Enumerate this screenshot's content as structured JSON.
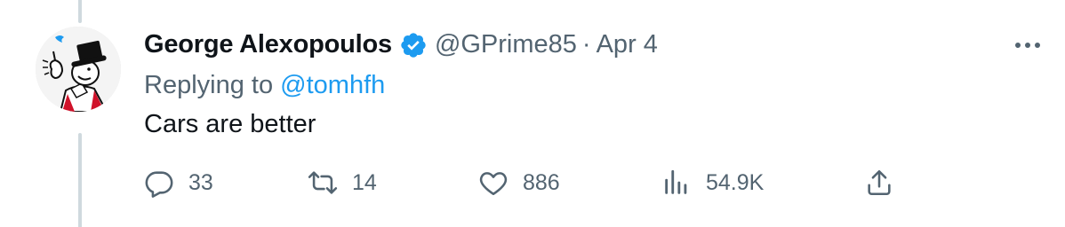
{
  "tweet": {
    "author": {
      "display_name": "George Alexopoulos",
      "handle": "@GPrime85",
      "verified": true,
      "avatar_icon": "top-hat-gentleman-avatar"
    },
    "separator": "·",
    "date": "Apr 4",
    "reply_prefix": "Replying to",
    "reply_to": "@tomhfh",
    "text": "Cars are better",
    "actions": {
      "reply": {
        "icon": "reply-icon",
        "count": "33"
      },
      "retweet": {
        "icon": "retweet-icon",
        "count": "14"
      },
      "like": {
        "icon": "heart-icon",
        "count": "886"
      },
      "views": {
        "icon": "views-chart-icon",
        "count": "54.9K"
      },
      "share": {
        "icon": "share-icon"
      }
    },
    "more_icon": "more-options-icon"
  },
  "colors": {
    "text_primary": "#0f1419",
    "text_secondary": "#536471",
    "accent": "#1d9bf0",
    "thread_line": "#cfd9de"
  }
}
